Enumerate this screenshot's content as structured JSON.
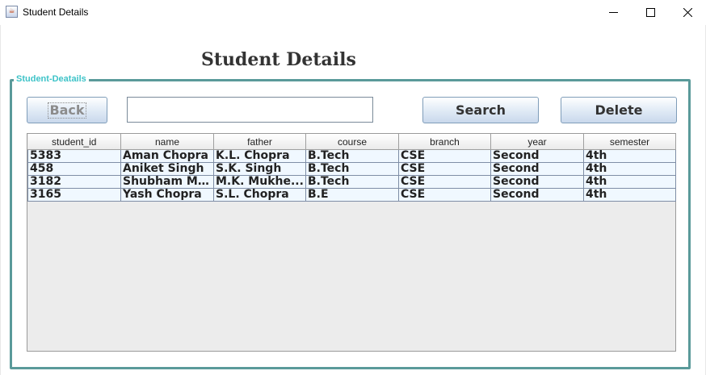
{
  "window": {
    "title": "Student Details",
    "controls": {
      "minimize": "minimize-icon",
      "maximize": "maximize-icon",
      "close": "close-icon"
    }
  },
  "page": {
    "heading": "Student Details"
  },
  "group": {
    "title": "Student-Deatails"
  },
  "toolbar": {
    "back_label": "Back",
    "search_value": "",
    "search_label": "Search",
    "delete_label": "Delete"
  },
  "table": {
    "columns": [
      "student_id",
      "name",
      "father",
      "course",
      "branch",
      "year",
      "semester"
    ],
    "rows": [
      [
        "5383",
        "Aman Chopra",
        "K.L. Chopra",
        "B.Tech",
        "CSE",
        "Second",
        "4th"
      ],
      [
        "458",
        "Aniket Singh",
        "S.K. Singh",
        "B.Tech",
        "CSE",
        "Second",
        "4th"
      ],
      [
        "3182",
        "Shubham Mu...",
        "M.K. Mukhe...",
        "B.Tech",
        "CSE",
        "Second",
        "4th"
      ],
      [
        "3165",
        "Yash Chopra",
        "S.L. Chopra",
        "B.E",
        "CSE",
        "Second",
        "4th"
      ]
    ]
  },
  "colors": {
    "group_border": "#5a9a9a",
    "group_title": "#3ec3c8",
    "row_background": "#f0f8ff",
    "table_empty": "#ececec"
  }
}
